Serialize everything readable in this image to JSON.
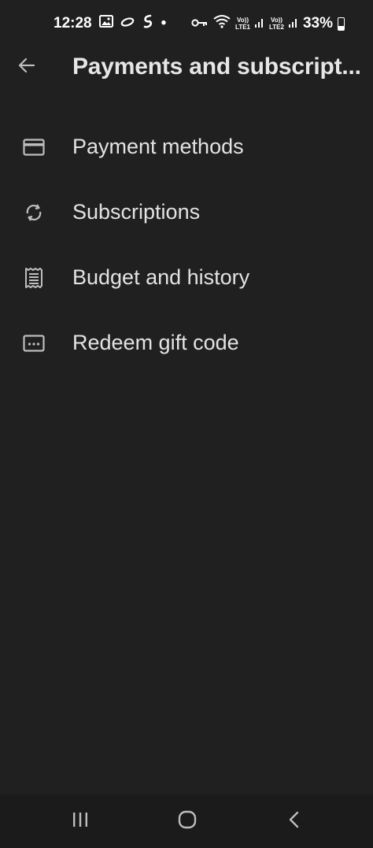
{
  "status_bar": {
    "time": "12:28",
    "lte1": {
      "top": "Vo))",
      "bottom": "LTE1"
    },
    "lte2": {
      "top": "Vo))",
      "bottom": "LTE2"
    },
    "battery_percent": "33%",
    "battery_level": 0.33,
    "dot": "•",
    "icons": [
      "gallery-icon",
      "link-icon",
      "shazam-icon",
      "vpn-key-icon",
      "wifi-icon",
      "signal-icon",
      "battery-icon"
    ]
  },
  "app_bar": {
    "title": "Payments and subscript...",
    "back_icon": "arrow-left-icon"
  },
  "menu": {
    "items": [
      {
        "label": "Payment methods",
        "icon": "credit-card-icon"
      },
      {
        "label": "Subscriptions",
        "icon": "sync-icon"
      },
      {
        "label": "Budget and history",
        "icon": "receipt-icon"
      },
      {
        "label": "Redeem gift code",
        "icon": "gift-code-icon"
      }
    ]
  },
  "nav_bar": {
    "buttons": [
      "recent-apps-icon",
      "home-icon",
      "back-icon"
    ]
  },
  "colors": {
    "background": "#202020",
    "text": "#e3e3e3",
    "icon": "#bdbdbd",
    "nav_background": "#1b1b1b"
  }
}
